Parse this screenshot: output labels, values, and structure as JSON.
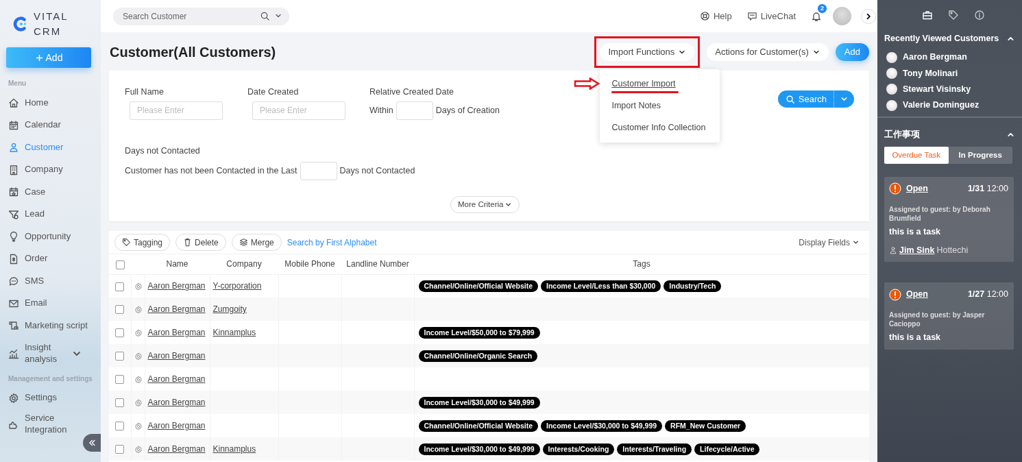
{
  "brand": {
    "name": "VITAL CRM"
  },
  "sidebar": {
    "add_label": "Add",
    "sections": [
      {
        "heading": "Menu",
        "items": [
          {
            "label": "Home",
            "selected": false
          },
          {
            "label": "Calendar",
            "selected": false
          },
          {
            "label": "Customer",
            "selected": true
          },
          {
            "label": "Company",
            "selected": false
          },
          {
            "label": "Case",
            "selected": false
          },
          {
            "label": "Lead",
            "selected": false
          },
          {
            "label": "Opportunity",
            "selected": false
          },
          {
            "label": "Order",
            "selected": false
          },
          {
            "label": "SMS",
            "selected": false
          },
          {
            "label": "Email",
            "selected": false
          },
          {
            "label": "Marketing script",
            "selected": false
          },
          {
            "label": "Insight analysis",
            "selected": false,
            "expandable": true
          }
        ]
      },
      {
        "heading": "Management and settings",
        "items": [
          {
            "label": "Settings",
            "selected": false
          },
          {
            "label": "Service Integration",
            "selected": false
          }
        ]
      }
    ]
  },
  "topbar": {
    "search": {
      "placeholder": "Search Customer"
    },
    "links": [
      {
        "label": "Help"
      },
      {
        "label": "LiveChat"
      }
    ],
    "notifications": {
      "count": "2"
    }
  },
  "page": {
    "title": "Customer(All Customers)",
    "actions": [
      {
        "label": "Import Functions",
        "kind": "dropdown",
        "expanded": true,
        "highlighted": true,
        "menu": [
          {
            "label": "Customer Import",
            "highlighted": true
          },
          {
            "label": "Import Notes",
            "highlighted": false
          },
          {
            "label": "Customer Info Collection",
            "highlighted": false
          }
        ]
      },
      {
        "label": "Actions for Customer(s)",
        "kind": "dropdown",
        "highlighted": false
      },
      {
        "label": "Add",
        "kind": "primary"
      }
    ]
  },
  "filters": {
    "fields": [
      {
        "label": "Full Name",
        "kind": "text",
        "placeholder": "Please Enter"
      },
      {
        "label": "Date Created",
        "kind": "text",
        "placeholder": "Please Enter"
      },
      {
        "label": "Relative Created Date",
        "kind": "days",
        "prefix": "Within",
        "suffix": "Days of Creation"
      }
    ],
    "search_button": "Search",
    "contacted": {
      "label": "Days not Contacted",
      "prefix": "Customer has not been Contacted in the Last",
      "suffix": "Days not Contacted"
    },
    "more_button": "More Criteria"
  },
  "table": {
    "toolbar": [
      {
        "label": "Tagging"
      },
      {
        "label": "Delete"
      },
      {
        "label": "Merge"
      }
    ],
    "alphabet_link": "Search by First Alphabet",
    "display_fields": "Display Fields",
    "all_checked": false,
    "columns": [
      "Name",
      "Company",
      "Mobile Phone",
      "Landline Number",
      "Tags"
    ],
    "rows": [
      {
        "checked": false,
        "name": "Aaron Bergman",
        "company": "Y-corporation",
        "tags": [
          "Channel/Online/Official Website",
          "Income Level/Less than $30,000",
          "Industry/Tech"
        ]
      },
      {
        "checked": false,
        "name": "Aaron Bergman",
        "company": "Zumgoity",
        "tags": []
      },
      {
        "checked": false,
        "name": "Aaron Bergman",
        "company": "Kinnamplus",
        "tags": [
          "Income Level/$50,000 to $79,999"
        ]
      },
      {
        "checked": false,
        "name": "Aaron Bergman",
        "tags": [
          "Channel/Online/Organic Search"
        ]
      },
      {
        "checked": false,
        "name": "Aaron Bergman",
        "tags": []
      },
      {
        "checked": false,
        "name": "Aaron Bergman",
        "tags": [
          "Income Level/$30,000 to $49,999"
        ]
      },
      {
        "checked": false,
        "name": "Aaron Bergman",
        "tags": [
          "Channel/Online/Official Website",
          "Income Level/$30,000 to $49,999",
          "RFM_New Customer"
        ]
      },
      {
        "checked": false,
        "name": "Aaron Bergman",
        "company": "Kinnamplus",
        "tags": [
          "Income Level/$30,000 to $49,999",
          "Interests/Cooking",
          "Interests/Traveling",
          "Lifecycle/Active"
        ]
      }
    ]
  },
  "right_panel": {
    "recent": {
      "title": "Recently Viewed Customers",
      "expanded": true,
      "customers": [
        "Aaron Bergman",
        "Tony Molinari",
        "Stewart Visinsky",
        "Valerie Dominguez"
      ]
    },
    "tasks": {
      "title": "工作事项",
      "expanded": true,
      "tabs": [
        {
          "label": "Overdue Task",
          "selected": true
        },
        {
          "label": "In Progress",
          "selected": false
        }
      ],
      "items": [
        {
          "status": "Open",
          "date": "1/31",
          "time": "12:00",
          "assignment": "Assigned to guest: by Deborah Brumfield",
          "description": "this is a task",
          "contact": "Jim Sink",
          "company": "Hottechi"
        },
        {
          "status": "Open",
          "date": "1/27",
          "time": "12:00",
          "assignment": "Assigned to guest: by Jasper Cacioppo",
          "description": "this is a task"
        }
      ]
    }
  }
}
